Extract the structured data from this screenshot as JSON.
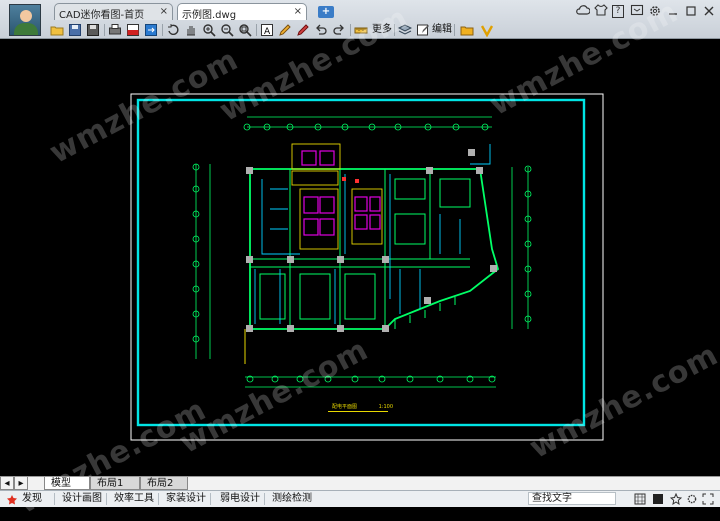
{
  "titlebar": {
    "tabs": [
      {
        "label": "CAD迷你看图-首页"
      },
      {
        "label": "示例图.dwg"
      }
    ],
    "add_tab": "+"
  },
  "toolbar": {
    "more_label": "更多",
    "edit_label": "编辑"
  },
  "drawing": {
    "plan_title": "配电平面图",
    "scale": "1:100"
  },
  "watermarks": [
    "wmzhe.com",
    "wmzhe.com",
    "wmzhe.com",
    "wmzhe.com",
    "wmzhe.com",
    "wmzhe.com"
  ],
  "sheet_tabs": [
    "模型",
    "布局1",
    "布局2"
  ],
  "statusbar": {
    "items": [
      "发现",
      "设计画图",
      "效率工具",
      "家装设计",
      "弱电设计",
      "测绘检测"
    ],
    "search_placeholder": "查找文字"
  },
  "colors": {
    "frame": "#00e5e5",
    "walls": "#00ff66",
    "stairs": "#e000e0",
    "accent": "#3a7cc7"
  }
}
